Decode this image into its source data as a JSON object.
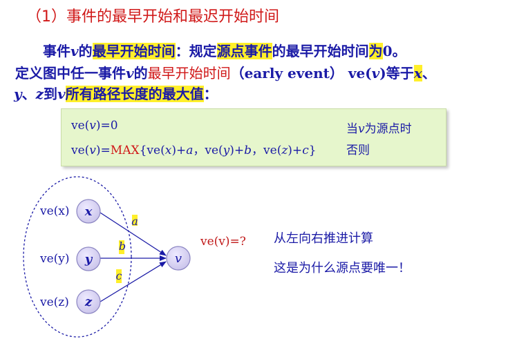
{
  "title": "（1）事件的最早开始和最迟开始时间",
  "paragraph": {
    "line1": {
      "p1": "事件",
      "v": "v",
      "p2": "的",
      "hl1": "最早开始时间",
      "p3": "：规定",
      "hl2": "源点事件",
      "p4": "的最早开始时间",
      "hl3": "为",
      "zero": "0",
      "p5": "。"
    },
    "line2": {
      "p1": "定义图中任一事件",
      "v": "v",
      "p2": "的",
      "red": "最早开始时间",
      "p3": "（early event） ve(",
      "v2": "v",
      "p4": ")等于",
      "x": "x",
      "p5": "、"
    },
    "line3": {
      "y": "y",
      "p1": "、",
      "z": "z",
      "p2": "到",
      "v": "v",
      "hl": "所有路径长度的最大值",
      "p3": "："
    }
  },
  "formula": {
    "row1": {
      "pre": "ve(",
      "v": "v",
      "post": ")=0",
      "cond": "当",
      "cond_v": "v",
      "cond2": "为源点时"
    },
    "row2": {
      "pre": "ve(",
      "v": "v",
      "mid": ")=",
      "max": "MAX",
      "b1": "{ve(",
      "x": "x",
      "b2": ")+",
      "a": "a",
      "b3": "，ve(",
      "y": "y",
      "b4": ")+",
      "b": "b",
      "b5": "，ve(",
      "z": "z",
      "b6": ")+",
      "c": "c",
      "b7": "}",
      "cond": "否则"
    }
  },
  "diagram": {
    "label_x": "ve(x)",
    "label_y": "ve(y)",
    "label_z": "ve(z)",
    "node_x": "x",
    "node_y": "y",
    "node_z": "z",
    "node_v": "v",
    "edge_a": "a",
    "edge_b": "b",
    "edge_c": "c",
    "question": "ve(v)=?"
  },
  "notes": {
    "line1": "从左向右推进计算",
    "line2": "这是为什么源点要唯一！"
  },
  "colors": {
    "title_red": "#d01818",
    "text_blue": "#1a1aa6",
    "highlight": "#ffef2a",
    "box_green": "#e6f6cc",
    "node_fill": "#d6d2ee",
    "node_stroke": "#8b85c2"
  }
}
